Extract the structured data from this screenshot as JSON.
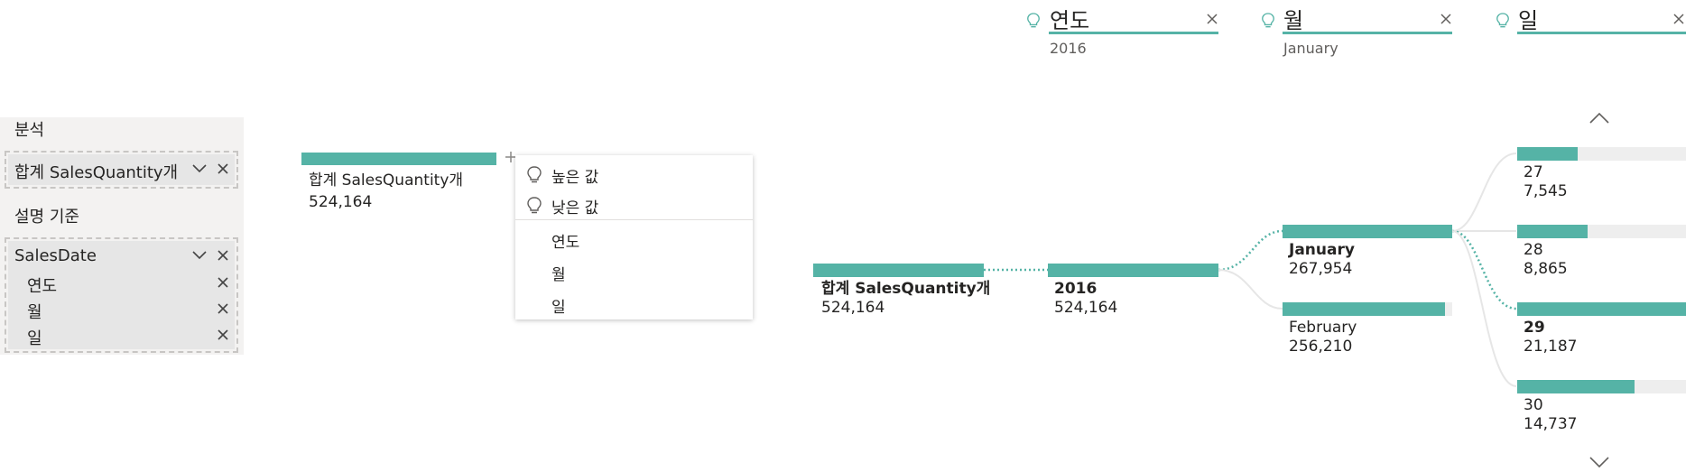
{
  "colors": {
    "accent": "#55b3a6",
    "track": "#eeeeee",
    "text": "#252423",
    "muted": "#605e5c"
  },
  "fields_pane": {
    "analyze_title": "분석",
    "analyze_field": "합계 SalesQuantity개",
    "explain_title": "설명 기준",
    "explain_field": "SalesDate",
    "sub_fields": [
      "연도",
      "월",
      "일"
    ]
  },
  "source_node": {
    "label": "합계 SalesQuantity개",
    "value": "524,164"
  },
  "expand_menu": {
    "items": [
      {
        "label": "높은 값",
        "icon": "lightbulb-icon"
      },
      {
        "label": "낮은 값",
        "icon": "lightbulb-icon"
      },
      {
        "label": "연도"
      },
      {
        "label": "월"
      },
      {
        "label": "일"
      }
    ]
  },
  "levels": [
    {
      "title": "연도",
      "selected": "2016"
    },
    {
      "title": "월",
      "selected": "January"
    },
    {
      "title": "일",
      "selected": ""
    }
  ],
  "tree": {
    "root": {
      "label": "합계 SalesQuantity개",
      "value": "524,164",
      "fraction": 1.0
    },
    "year": [
      {
        "label": "2016",
        "value": "524,164",
        "fraction": 1.0,
        "selected": true
      }
    ],
    "month": [
      {
        "label": "January",
        "value": "267,954",
        "fraction": 1.0,
        "selected": true
      },
      {
        "label": "February",
        "value": "256,210",
        "fraction": 0.956,
        "selected": false
      }
    ],
    "day": [
      {
        "label": "27",
        "value": "7,545",
        "fraction": 0.356,
        "selected": false
      },
      {
        "label": "28",
        "value": "8,865",
        "fraction": 0.418,
        "selected": false
      },
      {
        "label": "29",
        "value": "21,187",
        "fraction": 1.0,
        "selected": true
      },
      {
        "label": "30",
        "value": "14,737",
        "fraction": 0.696,
        "selected": false
      }
    ]
  }
}
